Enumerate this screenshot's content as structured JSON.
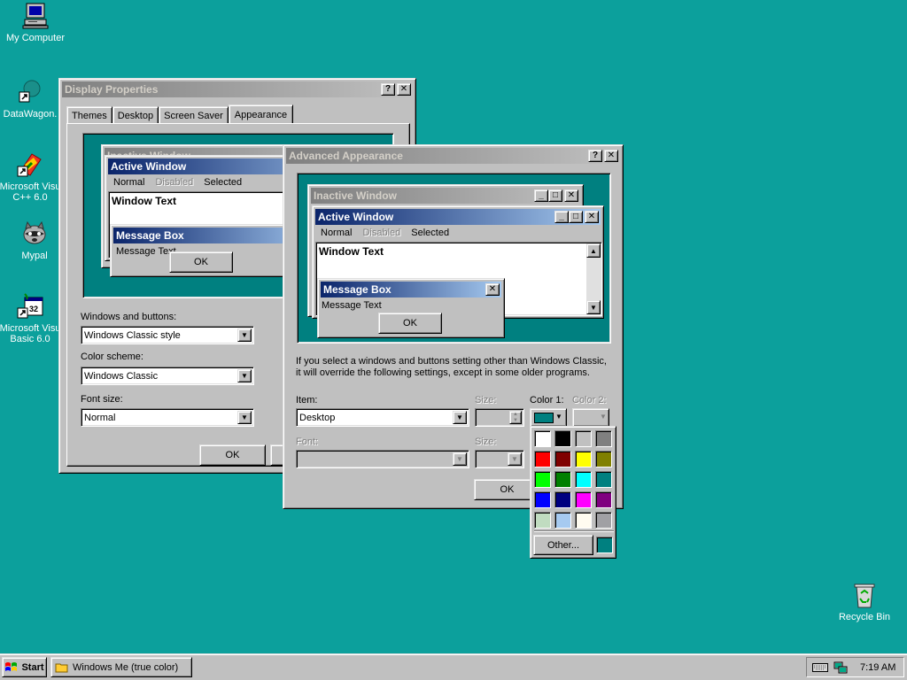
{
  "desktop": {
    "background": "#0ca09c",
    "icons": [
      {
        "label": "My Computer",
        "icon": "computer-icon"
      },
      {
        "label": "DataWagon.",
        "icon": "shortcut-icon"
      },
      {
        "label": "Microsoft Visu C++ 6.0",
        "icon": "vcpp-icon"
      },
      {
        "label": "Mypal",
        "icon": "raccoon-icon"
      },
      {
        "label": "Microsoft Visu Basic 6.0",
        "icon": "vb-icon"
      },
      {
        "label": "Recycle Bin",
        "icon": "recycle-bin-icon"
      }
    ]
  },
  "display_properties": {
    "title": "Display Properties",
    "tabs": [
      "Themes",
      "Desktop",
      "Screen Saver",
      "Appearance"
    ],
    "active_tab": "Appearance",
    "preview": {
      "inactive_title": "Inactive Window",
      "active_title": "Active Window",
      "menu": [
        "Normal",
        "Disabled",
        "Selected"
      ],
      "window_text": "Window Text",
      "msgbox_title": "Message Box",
      "msgbox_text": "Message Text",
      "ok": "OK"
    },
    "windows_buttons_label": "Windows and buttons:",
    "windows_buttons_value": "Windows Classic style",
    "color_scheme_label": "Color scheme:",
    "color_scheme_value": "Windows Classic",
    "font_size_label": "Font size:",
    "font_size_value": "Normal",
    "ok": "OK"
  },
  "advanced": {
    "title": "Advanced Appearance",
    "preview": {
      "inactive_title": "Inactive Window",
      "active_title": "Active Window",
      "menu": [
        "Normal",
        "Disabled",
        "Selected"
      ],
      "window_text": "Window Text",
      "msgbox_title": "Message Box",
      "msgbox_text": "Message Text",
      "ok": "OK"
    },
    "info_line1": "If you select a windows and buttons setting other than Windows Classic,",
    "info_line2": "it will override the following settings, except in some older programs.",
    "item_label": "Item:",
    "item_value": "Desktop",
    "size_label": "Size:",
    "color1_label": "Color 1:",
    "color2_label": "Color 2:",
    "font_label": "Font:",
    "font_size_label": "Size:",
    "ok": "OK",
    "color1_value": "#008080"
  },
  "color_picker": {
    "colors": [
      "#ffffff",
      "#000000",
      "#c0c0c0",
      "#808080",
      "#ff0000",
      "#800000",
      "#ffff00",
      "#808000",
      "#00ff00",
      "#008000",
      "#00ffff",
      "#008080",
      "#0000ff",
      "#000080",
      "#ff00ff",
      "#800080",
      "#c0dcc0",
      "#a6caf0",
      "#fffbf0",
      "#a0a0a4"
    ],
    "other_label": "Other...",
    "custom_color": "#008080"
  },
  "taskbar": {
    "start_label": "Start",
    "task_label": "Windows Me (true color)",
    "clock": "7:19 AM"
  }
}
